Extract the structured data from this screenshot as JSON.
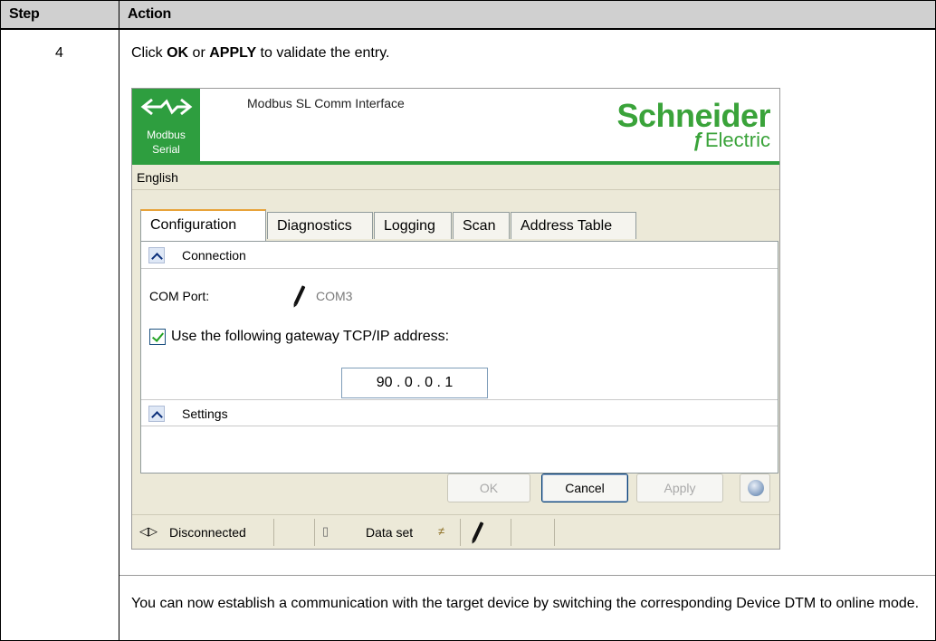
{
  "table": {
    "header_step": "Step",
    "header_action": "Action",
    "step_number": "4",
    "instruction_prefix": "Click ",
    "instruction_ok": "OK",
    "instruction_or": " or ",
    "instruction_apply": "APPLY",
    "instruction_suffix": " to validate the entry.",
    "footer_text": "You can now establish a communication with the target device by switching the corresponding Device DTM to online mode."
  },
  "window": {
    "logo_line1": "Modbus",
    "logo_line2": "Serial",
    "title": "Modbus SL Comm Interface",
    "brand_main": "Schneider",
    "brand_sub": "Electric",
    "language": "English",
    "tabs": [
      {
        "label": "Configuration",
        "active": true
      },
      {
        "label": "Diagnostics"
      },
      {
        "label": "Logging"
      },
      {
        "label": "Scan"
      },
      {
        "label": "Address Table"
      }
    ],
    "section_connection": "Connection",
    "com_port_label": "COM Port:",
    "com_port_value": "COM3",
    "gateway_checkbox_label": "Use the following gateway TCP/IP address:",
    "gateway_checked": true,
    "gateway_ip": "90 . 0 . 0 . 1",
    "section_settings": "Settings",
    "buttons": {
      "ok": "OK",
      "cancel": "Cancel",
      "apply": "Apply"
    },
    "status": {
      "connection": "Disconnected",
      "data_set": "Data set"
    },
    "colors": {
      "brand_green": "#2e9e3f",
      "tab_accent": "#e8a33a"
    }
  }
}
